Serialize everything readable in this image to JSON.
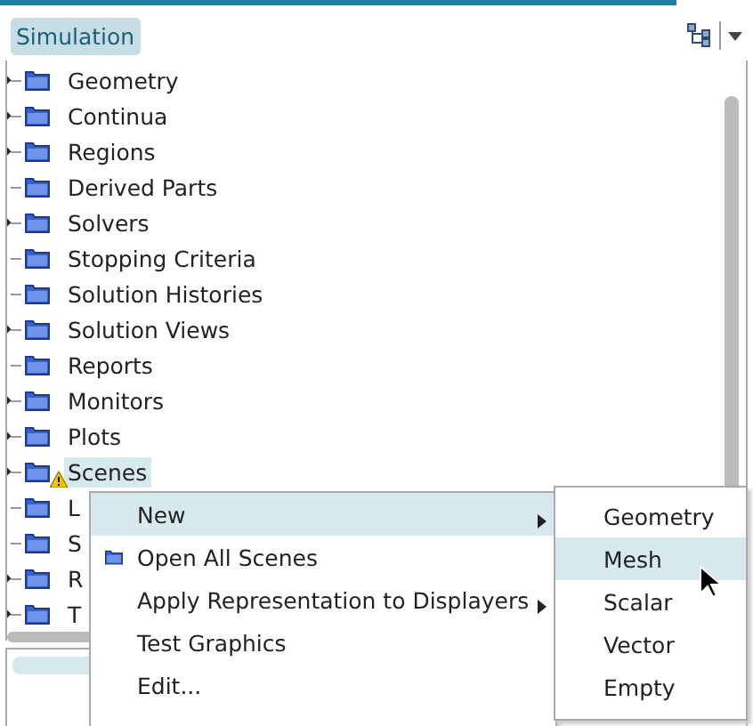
{
  "header": {
    "title": "Simulation"
  },
  "tree": [
    {
      "label": "Geometry",
      "expandable": true,
      "selected": false,
      "warning": false
    },
    {
      "label": "Continua",
      "expandable": true,
      "selected": false,
      "warning": false
    },
    {
      "label": "Regions",
      "expandable": true,
      "selected": false,
      "warning": false
    },
    {
      "label": "Derived Parts",
      "expandable": false,
      "selected": false,
      "warning": false
    },
    {
      "label": "Solvers",
      "expandable": true,
      "selected": false,
      "warning": false
    },
    {
      "label": "Stopping Criteria",
      "expandable": false,
      "selected": false,
      "warning": false
    },
    {
      "label": "Solution Histories",
      "expandable": false,
      "selected": false,
      "warning": false
    },
    {
      "label": "Solution Views",
      "expandable": true,
      "selected": false,
      "warning": false
    },
    {
      "label": "Reports",
      "expandable": false,
      "selected": false,
      "warning": false
    },
    {
      "label": "Monitors",
      "expandable": true,
      "selected": false,
      "warning": false
    },
    {
      "label": "Plots",
      "expandable": true,
      "selected": false,
      "warning": false
    },
    {
      "label": "Scenes",
      "expandable": true,
      "selected": true,
      "warning": true
    },
    {
      "label": "L",
      "expandable": false,
      "selected": false,
      "warning": false
    },
    {
      "label": "S",
      "expandable": false,
      "selected": false,
      "warning": false
    },
    {
      "label": "R",
      "expandable": true,
      "selected": false,
      "warning": false
    },
    {
      "label": "T",
      "expandable": true,
      "selected": false,
      "warning": false
    }
  ],
  "context_menu": [
    {
      "label": "New",
      "selected": true,
      "submenu": true,
      "icon": false
    },
    {
      "label": "Open All Scenes",
      "selected": false,
      "submenu": false,
      "icon": true
    },
    {
      "label": "Apply Representation to Displayers",
      "selected": false,
      "submenu": true,
      "icon": false
    },
    {
      "label": "Test Graphics",
      "selected": false,
      "submenu": false,
      "icon": false
    },
    {
      "label": "Edit...",
      "selected": false,
      "submenu": false,
      "icon": false
    }
  ],
  "submenu": [
    {
      "label": "Geometry",
      "selected": false
    },
    {
      "label": "Mesh",
      "selected": true
    },
    {
      "label": "Scalar",
      "selected": false
    },
    {
      "label": "Vector",
      "selected": false
    },
    {
      "label": "Empty",
      "selected": false
    }
  ]
}
